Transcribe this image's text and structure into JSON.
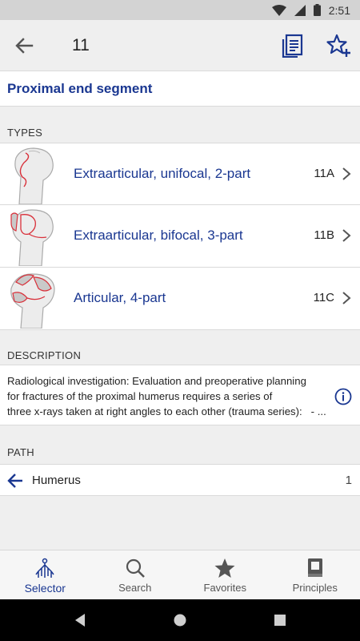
{
  "status_bar": {
    "time": "2:51"
  },
  "app_bar": {
    "title": "11",
    "back_icon": "arrow-left-icon",
    "doc_icon": "document-list-icon",
    "star_icon": "star-add-icon"
  },
  "segment": {
    "title": "Proximal end segment"
  },
  "types": {
    "header": "TYPES",
    "items": [
      {
        "label": "Extraarticular, unifocal, 2-part",
        "code": "11A"
      },
      {
        "label": "Extraarticular, bifocal, 3-part",
        "code": "11B"
      },
      {
        "label": "Articular, 4-part",
        "code": "11C"
      }
    ]
  },
  "description": {
    "header": "DESCRIPTION",
    "line1": "Radiological investigation: Evaluation and preoperative planning",
    "line2": "for fractures of the proximal humerus requires a series of",
    "line3": "three x-rays taken at right angles to each other (trauma series):   - ..."
  },
  "path": {
    "header": "PATH",
    "label": "Humerus",
    "count": "1"
  },
  "bottom_nav": {
    "items": [
      {
        "label": "Selector",
        "active": true
      },
      {
        "label": "Search",
        "active": false
      },
      {
        "label": "Favorites",
        "active": false
      },
      {
        "label": "Principles",
        "active": false
      }
    ]
  },
  "colors": {
    "accent": "#1a3791",
    "fracture_red": "#d9303a"
  }
}
